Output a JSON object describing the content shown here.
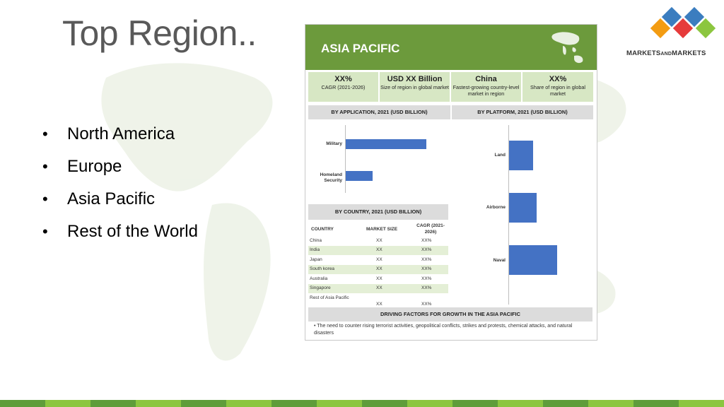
{
  "slide": {
    "title": "Top Region..",
    "bullets": [
      "North America",
      "Europe",
      "Asia Pacific",
      "Rest of the World"
    ]
  },
  "logo": {
    "text_main": "MARKETS",
    "text_small": "AND",
    "text_end": "MARKETS",
    "colors": [
      "#3b7dbf",
      "#e63b3b",
      "#8cc63f",
      "#f39c12"
    ]
  },
  "colors": {
    "header_green": "#6c9a3c",
    "stat_green": "#d7e7c4",
    "bar_blue": "#4472c4",
    "table_alt": "#e4efd6"
  },
  "infographic": {
    "region": "ASIA PACIFIC",
    "stats": [
      {
        "big": "XX%",
        "small": "CAGR (2021-2026)"
      },
      {
        "big": "USD XX Billion",
        "small": "Size of region in global market"
      },
      {
        "big": "China",
        "small": "Fastest-growing country-level market in region"
      },
      {
        "big": "XX%",
        "small": "Share of region in global market"
      }
    ],
    "by_application_title": "BY APPLICATION, 2021 (USD BILLION)",
    "by_platform_title": "BY PLATFORM, 2021 (USD BILLION)",
    "by_country_title": "BY COUNTRY, 2021 (USD BILLION)",
    "application_bars": [
      {
        "label": "Military",
        "value": 0.92
      },
      {
        "label": "Homeland Security",
        "value": 0.31
      }
    ],
    "platform_bars": [
      {
        "label": "Land",
        "value": 0.5
      },
      {
        "label": "Airborne",
        "value": 0.58
      },
      {
        "label": "Naval",
        "value": 1.0
      }
    ],
    "table": {
      "headers": [
        "COUNTRY",
        "MARKET SIZE",
        "CAGR (2021-2026)"
      ],
      "rows": [
        [
          "China",
          "XX",
          "XX%"
        ],
        [
          "India",
          "XX",
          "XX%"
        ],
        [
          "Japan",
          "XX",
          "XX%"
        ],
        [
          "South korea",
          "XX",
          "XX%"
        ],
        [
          "Australia",
          "XX",
          "XX%"
        ],
        [
          "Singapore",
          "XX",
          "XX%"
        ],
        [
          "Rest of Asia Pacific",
          "XX",
          "XX%"
        ]
      ]
    },
    "driving_title": "DRIVING FACTORS FOR GROWTH IN THE ASIA PACIFIC",
    "driving_text": "The need to counter rising terrorist activities, geopolitical conflicts, strikes and protests, chemical attacks, and natural disasters"
  }
}
